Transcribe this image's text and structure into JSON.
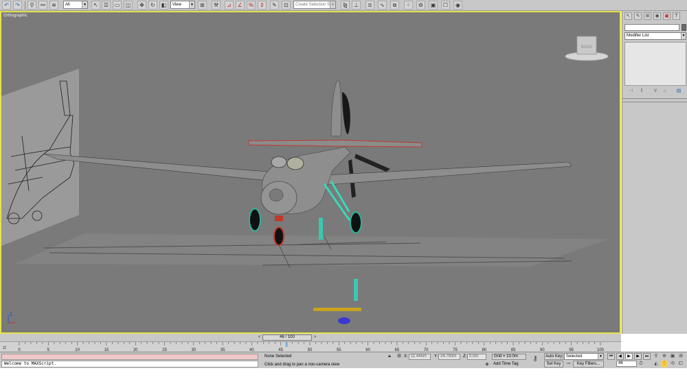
{
  "toolbar": {
    "selection_filter": "All",
    "reference_coord": "View",
    "named_selection_placeholder": "Create Selection Se"
  },
  "viewport": {
    "label": "Orthographic",
    "viewcube_face": "BACK",
    "axis_label": "Z"
  },
  "command_panel": {
    "modifier_list": "Modifier List"
  },
  "time_slider": {
    "frame_label": "46 / 100",
    "prev": "<",
    "next": ">"
  },
  "track": {
    "ticks": [
      "0",
      "5",
      "10",
      "15",
      "20",
      "25",
      "30",
      "35",
      "40",
      "45",
      "50",
      "55",
      "60",
      "65",
      "70",
      "75",
      "80",
      "85",
      "90",
      "95",
      "100"
    ],
    "current_frame": 46,
    "total_frames": 100
  },
  "status": {
    "maxscript_output": "Welcome to MAXScript.",
    "selection_status": "None Selected",
    "prompt": "Click and drag to pan a non-camera view",
    "x_label": "X:",
    "x_value": "11.445m",
    "y_label": "Y:",
    "y_value": "24.793m",
    "z_label": "Z:",
    "z_value": "0.0m",
    "grid": "Grid = 10.0m",
    "add_time_tag": "Add Time Tag",
    "auto_key": "Auto Key",
    "auto_key_mode": "Selected",
    "set_key": "Set Key",
    "key_filters": "Key Filters...",
    "current_frame_field": "46"
  },
  "colors": {
    "viewport_bg": "#7a7a7a",
    "active_border": "#e8e24a",
    "ui_gray": "#c8c8c8"
  }
}
